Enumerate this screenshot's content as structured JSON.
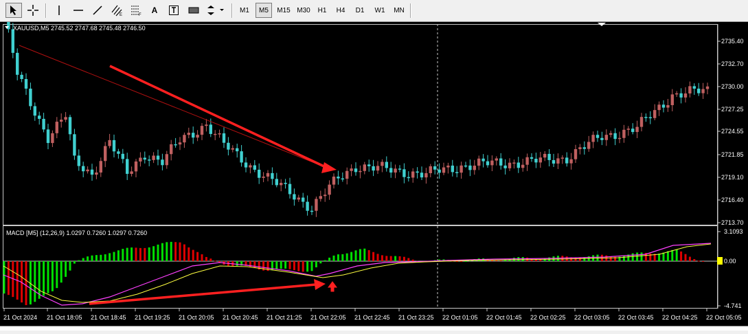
{
  "toolbar": {
    "timeframes": [
      "M1",
      "M5",
      "M15",
      "M30",
      "H1",
      "H4",
      "D1",
      "W1",
      "MN"
    ],
    "active_timeframe": "M5",
    "text_tool_label": "A"
  },
  "main_chart": {
    "symbol_header": "XAUUSD,M5  2745.52 2747.68 2745.48 2746.50",
    "price_labels": [
      "2735.40",
      "2732.70",
      "2730.00",
      "2727.25",
      "2724.55",
      "2721.85",
      "2719.10",
      "2716.40",
      "2713.70"
    ]
  },
  "macd": {
    "header": "MACD [M5] (12,26,9) 1.0297 0.7260 1.0297 0.7260",
    "scale_labels": [
      "3.1093",
      "0.00",
      "-4.741"
    ]
  },
  "time_axis": {
    "labels": [
      "21 Oct 2024",
      "21 Oct 18:05",
      "21 Oct 18:45",
      "21 Oct 19:25",
      "21 Oct 20:05",
      "21 Oct 20:45",
      "21 Oct 21:25",
      "21 Oct 22:05",
      "21 Oct 22:45",
      "21 Oct 23:25",
      "22 Oct 01:05",
      "22 Oct 01:45",
      "22 Oct 02:25",
      "22 Oct 03:05",
      "22 Oct 03:45",
      "22 Oct 04:25",
      "22 Oct 05:05"
    ]
  },
  "colors": {
    "bull": "#c06060",
    "bear": "#40d0d0",
    "hist_up": "#00e000",
    "hist_down": "#e00000",
    "macd_line": "#ff40ff",
    "signal_line": "#ffff40",
    "arrow": "#ff2020"
  }
}
